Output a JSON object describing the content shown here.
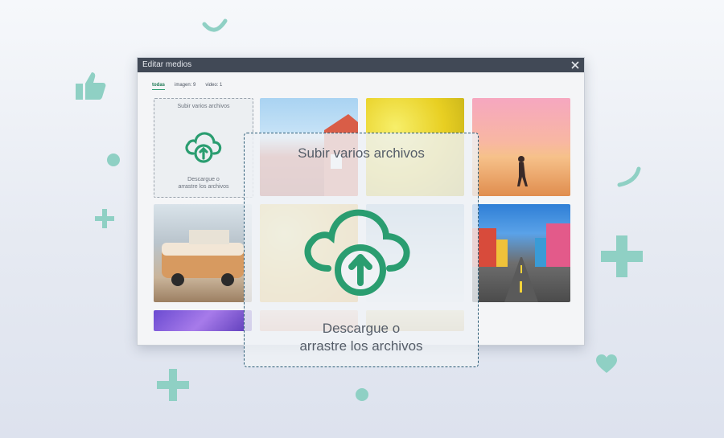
{
  "dialog": {
    "title": "Editar medios",
    "tabs": [
      {
        "label": "todas",
        "active": true
      },
      {
        "label": "imagen: 9",
        "active": false
      },
      {
        "label": "video: 1",
        "active": false
      }
    ]
  },
  "small_drop": {
    "title": "Subir varios archivos",
    "hint_line1": "Descargue o",
    "hint_line2": "arrastre los archivos"
  },
  "overlay_drop": {
    "title": "Subir varios archivos",
    "hint_line1": "Descargue o",
    "hint_line2": "arrastre los archivos"
  },
  "media_items": [
    {
      "name": "red-house-image",
      "icon": "image"
    },
    {
      "name": "yellow-flowers-image",
      "icon": "image"
    },
    {
      "name": "beach-walker-image",
      "icon": "image"
    },
    {
      "name": "orange-van-image",
      "icon": "image"
    },
    {
      "name": "citrus-slices-image",
      "icon": "image"
    },
    {
      "name": "snowy-mountain-image",
      "icon": "image"
    },
    {
      "name": "colorful-street-image",
      "icon": "image"
    },
    {
      "name": "purple-video-thumbnail",
      "icon": "video"
    }
  ],
  "colors": {
    "accent": "#2a9d70",
    "titlebar": "#414956",
    "overlay_border": "#2d5d77",
    "decor": "#8fd0c4"
  }
}
